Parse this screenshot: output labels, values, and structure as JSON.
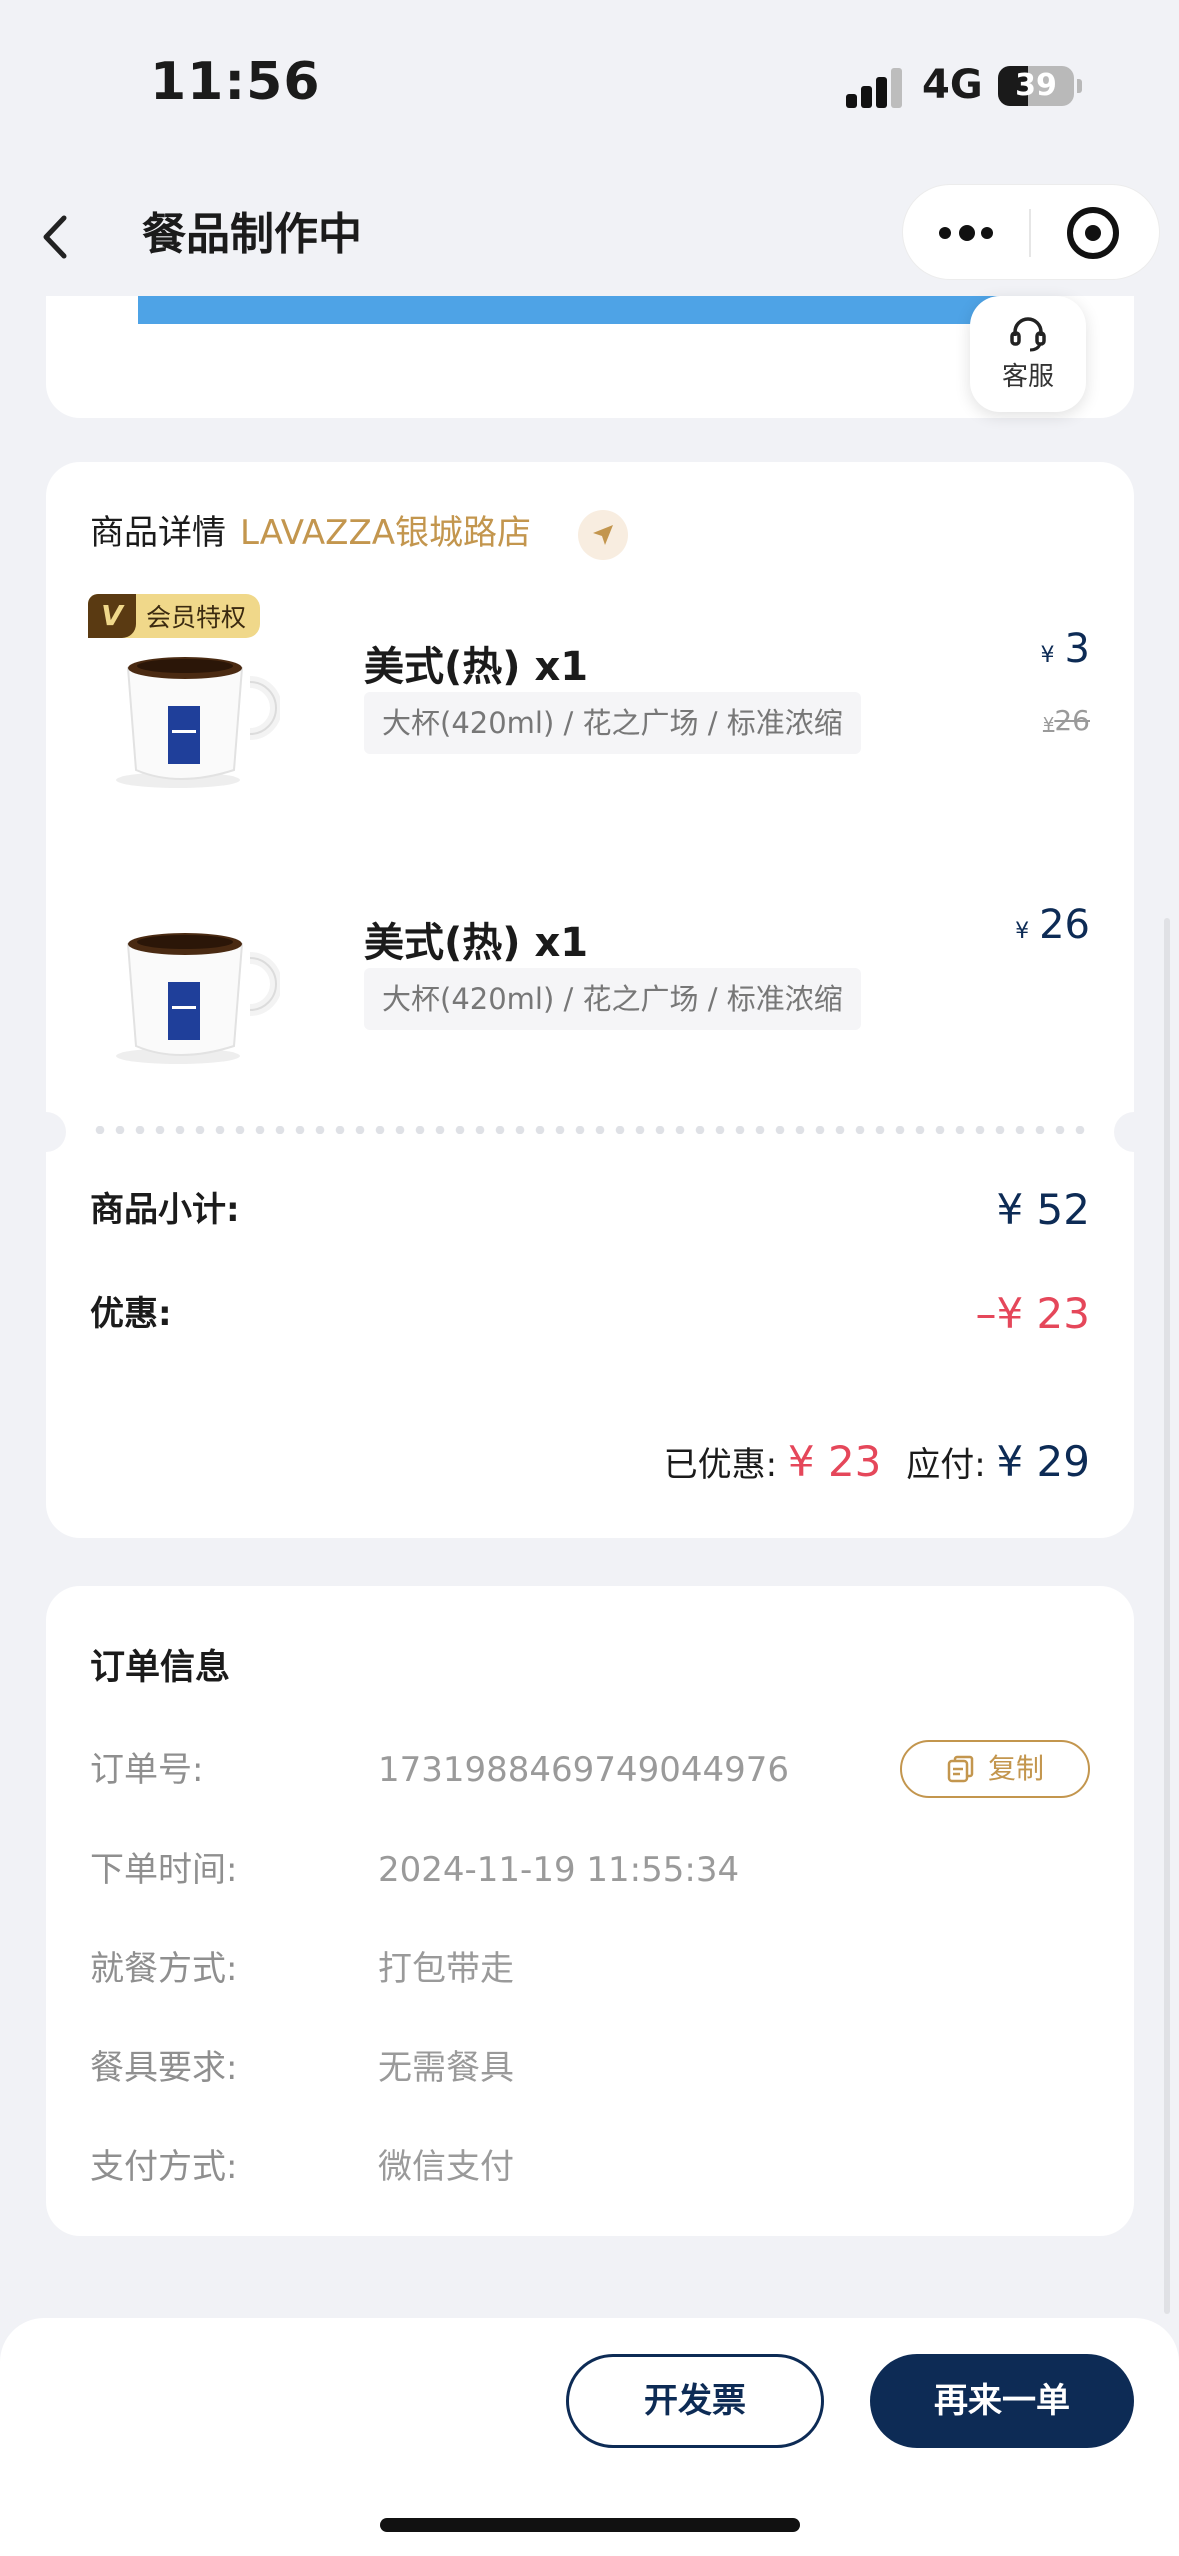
{
  "status_bar": {
    "time": "11:56",
    "network": "4G",
    "battery": "39"
  },
  "nav": {
    "title": "餐品制作中"
  },
  "customer_service": {
    "label": "客服"
  },
  "goods": {
    "title": "商品详情",
    "store": "LAVAZZA银城路店",
    "items": [
      {
        "badge": "会员特权",
        "badge_letter": "V",
        "name": "美式(热) x1",
        "spec": "大杯(420ml) / 花之广场 / 标准浓缩",
        "currency": "¥",
        "price": "3",
        "original_currency": "¥",
        "original_price": "26"
      },
      {
        "name": "美式(热) x1",
        "spec": "大杯(420ml) / 花之广场 / 标准浓缩",
        "currency": "¥",
        "price": "26"
      }
    ],
    "subtotal_label": "商品小计:",
    "subtotal_value": "¥ 52",
    "discount_label": "优惠:",
    "discount_value": "–¥ 23",
    "saved_label": "已优惠:",
    "saved_value": "¥ 23",
    "payable_label": "应付:",
    "payable_value": "¥ 29"
  },
  "order_info": {
    "title": "订单信息",
    "copy_label": "复制",
    "rows": [
      {
        "key": "订单号:",
        "value": "1731988469749044976"
      },
      {
        "key": "下单时间:",
        "value": "2024-11-19 11:55:34"
      },
      {
        "key": "就餐方式:",
        "value": "打包带走"
      },
      {
        "key": "餐具要求:",
        "value": "无需餐具"
      },
      {
        "key": "支付方式:",
        "value": "微信支付"
      }
    ]
  },
  "actions": {
    "invoice": "开发票",
    "reorder": "再来一单"
  },
  "colors": {
    "navy": "#0d2b55",
    "gold": "#c3964e",
    "red": "#e5475a",
    "background": "#f1f2f6"
  }
}
